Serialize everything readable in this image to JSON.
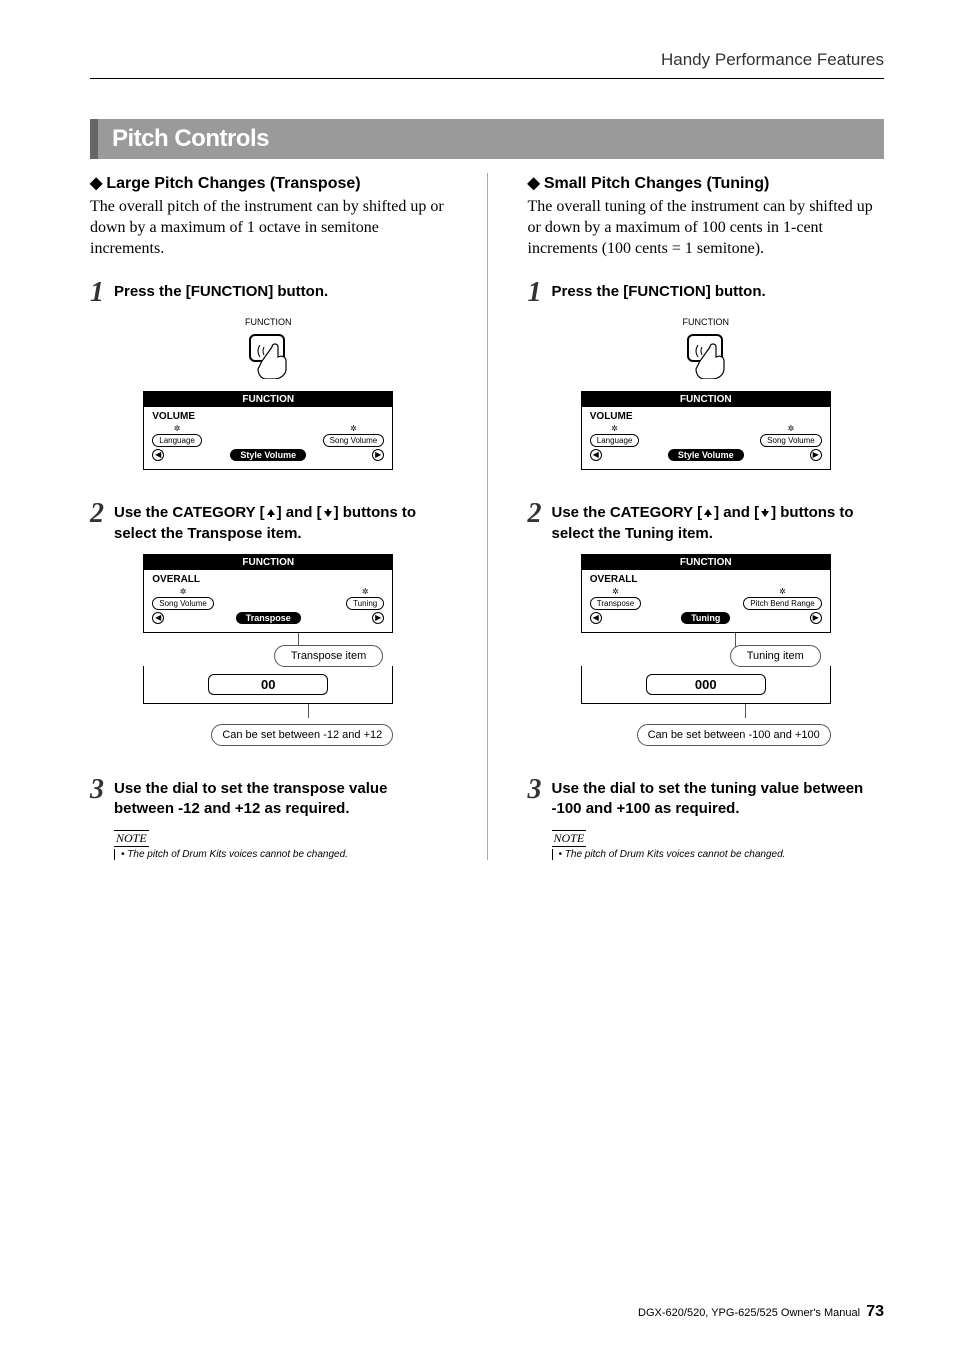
{
  "header": {
    "running_title": "Handy Performance Features"
  },
  "section_title": "Pitch Controls",
  "left": {
    "subheading": "Large Pitch Changes (Transpose)",
    "intro": "The overall pitch of the instrument can by shifted up or down by a maximum of 1 octave in semitone increments.",
    "step1": {
      "num": "1",
      "text": "Press the [FUNCTION] button."
    },
    "fig1": {
      "label": "FUNCTION",
      "lcd_title": "FUNCTION",
      "lcd_cat": "VOLUME",
      "lcd_left": "Language",
      "lcd_center": "Style Volume",
      "lcd_right": "Song Volume"
    },
    "step2": {
      "num": "2",
      "text_a": "Use the CATEGORY [",
      "text_b": "] and [",
      "text_c": "] buttons to select the Transpose item."
    },
    "fig2": {
      "lcd_title": "FUNCTION",
      "lcd_cat": "OVERALL",
      "lcd_left": "Song Volume",
      "lcd_center": "Transpose",
      "lcd_right": "Tuning",
      "callout_item": "Transpose item",
      "value": "00",
      "callout_range": "Can be set between -12 and +12"
    },
    "step3": {
      "num": "3",
      "text": "Use the dial to set the transpose value between -12 and +12 as required."
    },
    "note": {
      "label": "NOTE",
      "text": "• The pitch of Drum Kits voices cannot be changed."
    }
  },
  "right": {
    "subheading": "Small Pitch Changes (Tuning)",
    "intro": "The overall tuning of the instrument can by shifted up or down by a maximum of 100 cents in 1-cent increments (100 cents = 1 semitone).",
    "step1": {
      "num": "1",
      "text": "Press the [FUNCTION] button."
    },
    "fig1": {
      "label": "FUNCTION",
      "lcd_title": "FUNCTION",
      "lcd_cat": "VOLUME",
      "lcd_left": "Language",
      "lcd_center": "Style Volume",
      "lcd_right": "Song Volume"
    },
    "step2": {
      "num": "2",
      "text_a": "Use the CATEGORY [",
      "text_b": "] and [",
      "text_c": "] buttons to select the Tuning item."
    },
    "fig2": {
      "lcd_title": "FUNCTION",
      "lcd_cat": "OVERALL",
      "lcd_left": "Transpose",
      "lcd_center": "Tuning",
      "lcd_right": "Pitch Bend Range",
      "callout_item": "Tuning item",
      "value": "000",
      "callout_range": "Can be set between -100 and +100"
    },
    "step3": {
      "num": "3",
      "text": "Use the dial to set the tuning value between -100 and +100 as required."
    },
    "note": {
      "label": "NOTE",
      "text": "• The pitch of Drum Kits voices cannot be changed."
    }
  },
  "footer": {
    "manual": "DGX-620/520, YPG-625/525  Owner's Manual",
    "page": "73"
  }
}
